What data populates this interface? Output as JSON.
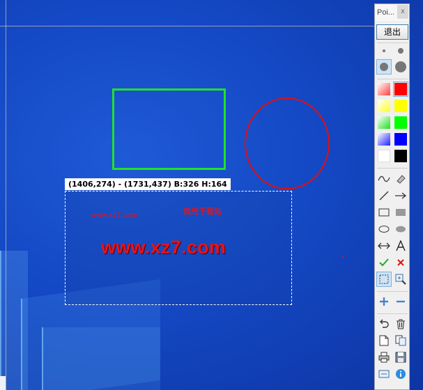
{
  "toolbar": {
    "title": "Poi...",
    "close_label": "x",
    "exit_label": "退出"
  },
  "selection": {
    "info": "(1406,274) - (1731,437)  B:326 H:164"
  },
  "canvas_text": {
    "watermark_small": "www.xz7.com",
    "watermark_cn": "极光下载站",
    "watermark_big": "www.xz7.com"
  },
  "colors": {
    "rect_outline": "#21e12a",
    "ellipse_outline": "#e01010",
    "watermark": "#e3141d",
    "desktop": "#1448c4",
    "swatches": [
      "#ff0000",
      "#ffff00",
      "#00ff00",
      "#0000ff",
      "#ffffff",
      "#000000"
    ]
  },
  "icons": [
    "pen-size-small-icon",
    "pen-size-medium-icon",
    "pen-size-large-icon",
    "pen-size-xlarge-icon",
    "freehand-icon",
    "eraser-icon",
    "line-icon",
    "arrow-icon",
    "rectangle-icon",
    "filled-rectangle-icon",
    "ellipse-icon",
    "filled-ellipse-icon",
    "double-arrow-icon",
    "text-icon",
    "checkmark-icon",
    "cross-icon",
    "select-icon",
    "zoom-icon",
    "plus-icon",
    "minus-icon",
    "undo-icon",
    "trash-icon",
    "new-page-icon",
    "copy-icon",
    "print-icon",
    "save-icon",
    "settings-icon",
    "info-icon"
  ]
}
